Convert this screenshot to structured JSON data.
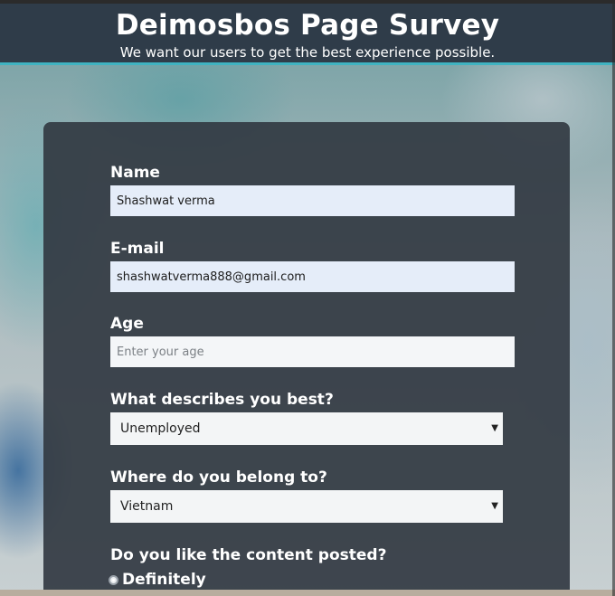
{
  "header": {
    "title": "Deimosbos Page Survey",
    "subtitle": "We want our users to get the best experience possible."
  },
  "form": {
    "name": {
      "label": "Name",
      "value": "Shashwat verma"
    },
    "email": {
      "label": "E-mail",
      "value": "shashwatverma888@gmail.com"
    },
    "age": {
      "label": "Age",
      "placeholder": "Enter your age"
    },
    "role": {
      "label": "What describes you best?",
      "selected": "Unemployed"
    },
    "country": {
      "label": "Where do you belong to?",
      "selected": "Vietnam"
    },
    "content": {
      "label": "Do you like the content posted?",
      "option1": "Definitely"
    }
  },
  "icons": {
    "dropdown": "triangle-down-icon",
    "radio": "radio-icon"
  },
  "colors": {
    "header_bg": "#2f3c49",
    "accent": "#3fb3c1",
    "card_bg": "#323942"
  }
}
